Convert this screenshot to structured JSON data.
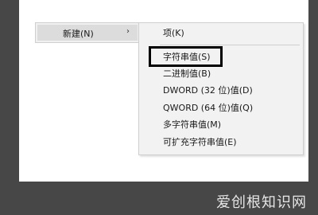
{
  "parent_menu": {
    "item_label": "新建(N)",
    "arrow": "›"
  },
  "submenu": {
    "items": [
      {
        "label": "项(K)"
      },
      {
        "label": "字符串值(S)"
      },
      {
        "label": "二进制值(B)"
      },
      {
        "label": "DWORD (32 位)值(D)"
      },
      {
        "label": "QWORD (64 位)值(Q)"
      },
      {
        "label": "多字符串值(M)"
      },
      {
        "label": "可扩充字符串值(E)"
      }
    ]
  },
  "watermark": "爱创根知识网",
  "colors": {
    "background_frame": "#474747",
    "menu_bg": "#f2f2f2",
    "highlight_border": "#000000"
  }
}
